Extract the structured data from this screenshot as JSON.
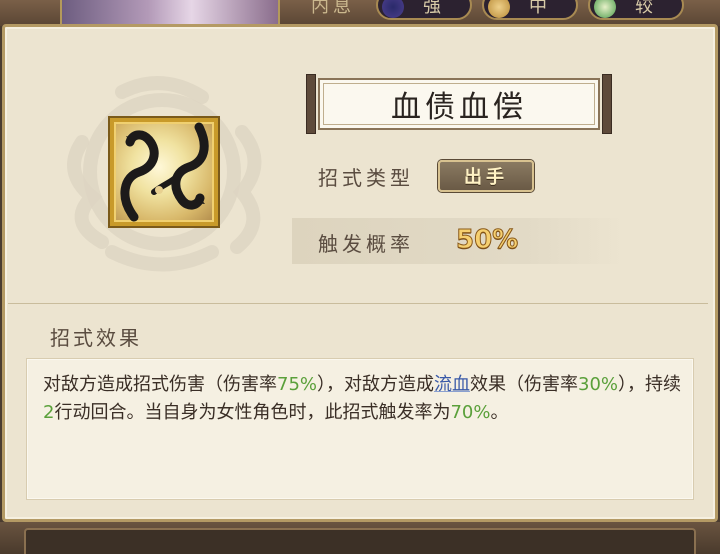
{
  "top_tabs": {
    "neixi": "内息",
    "qiang": "强",
    "zhong": "中",
    "ruo": "较"
  },
  "skill": {
    "name": "血债血偿",
    "icon": "black-snakes-icon"
  },
  "info": {
    "type_label": "招式类型",
    "type_value": "出手",
    "trigger_label": "触发概率",
    "trigger_value": "50%"
  },
  "effect": {
    "section_title": "招式效果",
    "segments": [
      "对敌方造成招式伤害（伤害率",
      "75%",
      "），对敌方造成",
      "流血",
      "效果（伤害率",
      "30%",
      "），持续",
      "2",
      "行动回合。当自身为女性角色时，此招式触发率为",
      "70%",
      "。"
    ]
  },
  "colors": {
    "highlight_green": "#5aa03a",
    "highlight_blue": "#3a5aa8",
    "trigger_gold": "#f6d070",
    "panel_bg": "#ece4d0"
  }
}
